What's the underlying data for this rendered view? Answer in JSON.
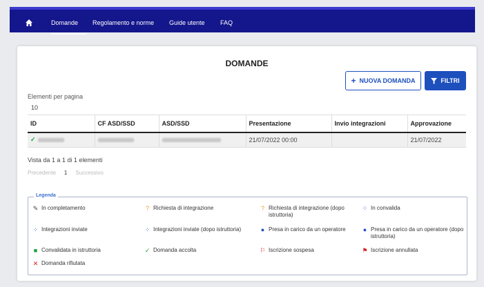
{
  "nav": {
    "items": [
      "Domande",
      "Regolamento e norme",
      "Guide utente",
      "FAQ"
    ],
    "active": "Domande"
  },
  "page": {
    "title": "DOMANDE",
    "new_button": "NUOVA DOMANDA",
    "filter_button": "FILTRI"
  },
  "pagination": {
    "per_page_label": "Elementi per pagina",
    "per_page_value": "10",
    "view_info": "Vista da 1 a 1 di 1 elementi",
    "prev": "Precedente",
    "current": "1",
    "next": "Successivo"
  },
  "table": {
    "columns": [
      "ID",
      "CF ASD/SSD",
      "ASD/SSD",
      "Presentazione",
      "Invio integrazioni",
      "Approvazione"
    ],
    "rows": [
      {
        "presentazione": "21/07/2022 00:00",
        "invio": "",
        "approvazione": "21/07/2022"
      }
    ]
  },
  "legend": {
    "title": "Legenda",
    "items": [
      {
        "icon": "pencil-icon",
        "label": "In completamento",
        "color": "#444444"
      },
      {
        "icon": "question-icon",
        "label": "Richiesta di integrazione",
        "color": "#f0a020"
      },
      {
        "icon": "question-icon",
        "label": "Richiesta di integrazione (dopo istruttoria)",
        "color": "#f0a020"
      },
      {
        "icon": "spinner-icon",
        "label": "In convalida",
        "color": "#1d4fbd"
      },
      {
        "icon": "spinner-icon",
        "label": "Integrazioni inviate",
        "color": "#1d4fbd"
      },
      {
        "icon": "spinner-icon",
        "label": "Integrazioni inviate (dopo istruttoria)",
        "color": "#1d4fbd"
      },
      {
        "icon": "user-icon",
        "label": "Presa in carico da un operatore",
        "color": "#1d4fbd"
      },
      {
        "icon": "user-icon",
        "label": "Presa in carico da un operatore (dopo istruttoria)",
        "color": "#1d4fbd"
      },
      {
        "icon": "bookmark-icon",
        "label": "Convalidata in istruttoria",
        "color": "#1a9e3f"
      },
      {
        "icon": "check-icon",
        "label": "Domanda accolta",
        "color": "#1a9e3f"
      },
      {
        "icon": "flag-outline-icon",
        "label": "Iscrizione sospesa",
        "color": "#d62020"
      },
      {
        "icon": "flag-icon",
        "label": "Iscrizione annullata",
        "color": "#d62020"
      },
      {
        "icon": "x-icon",
        "label": "Domanda rifiutata",
        "color": "#d62020"
      }
    ]
  }
}
